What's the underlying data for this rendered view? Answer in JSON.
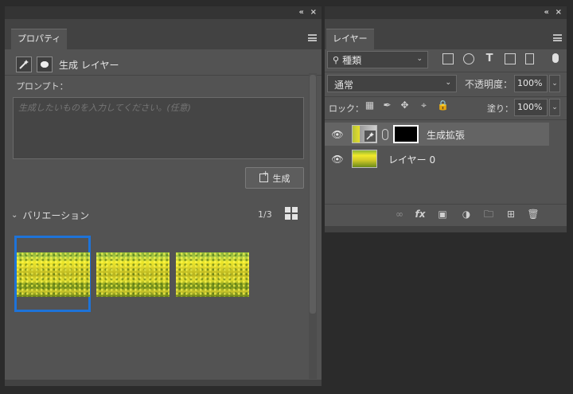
{
  "properties_panel": {
    "tab_label": "プロパティ",
    "collapse_glyph": "«",
    "close_glyph": "×",
    "header_title": "生成 レイヤー",
    "prompt_label": "プロンプト：",
    "prompt_placeholder": "生成したいものを入力してください。(任意)",
    "generate_button": "生成",
    "variations_label": "バリエーション",
    "variations_count": "1/3",
    "selected_variation": 1
  },
  "layers_panel": {
    "tab_label": "レイヤー",
    "collapse_glyph": "«",
    "close_glyph": "×",
    "filter_kind": "種類",
    "blend_mode": "通常",
    "opacity_label": "不透明度：",
    "opacity_value": "100%",
    "lock_label": "ロック：",
    "fill_label": "塗り：",
    "fill_value": "100%",
    "layers": [
      {
        "name": "生成拡張",
        "visible": true,
        "selected": true,
        "has_mask": true
      },
      {
        "name": "レイヤー 0",
        "visible": true,
        "selected": false,
        "has_mask": false
      }
    ],
    "footer_icons": [
      "link-icon",
      "fx-icon",
      "add-mask-icon",
      "adjustment-icon",
      "folder-icon",
      "new-layer-icon",
      "trash-icon"
    ]
  },
  "colors": {
    "panel_bg": "#535353",
    "accent_selection": "#1e73d8",
    "app_bg": "#2b2b2b"
  }
}
